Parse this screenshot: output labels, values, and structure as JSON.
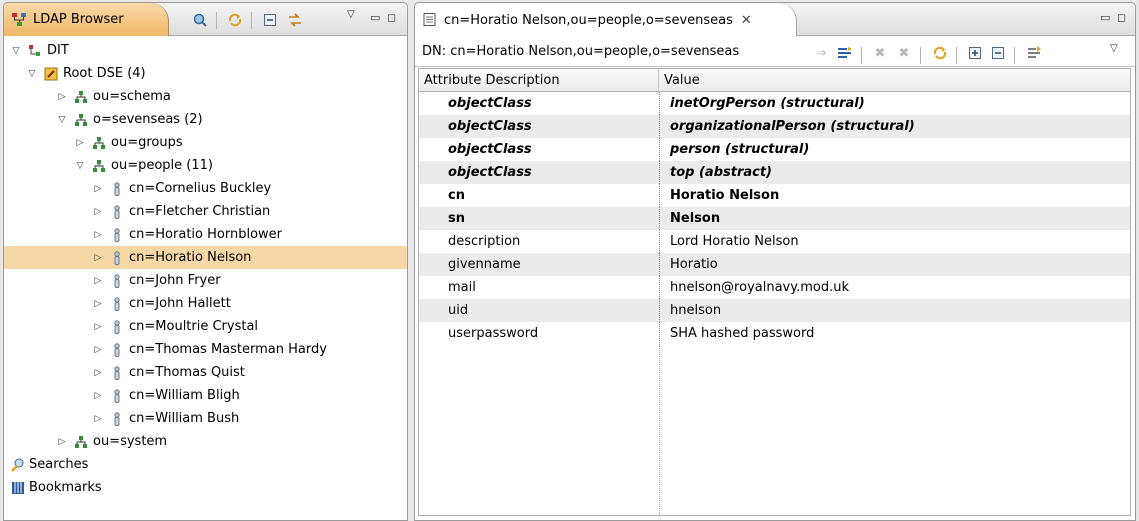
{
  "browser_panel": {
    "tab_label": "LDAP Browser",
    "toolbar_icons": [
      "search-icon",
      "refresh-icon",
      "collapse-all-icon",
      "link-with-editor-icon",
      "view-menu-icon"
    ]
  },
  "tree": {
    "rows": [
      {
        "label": "DIT",
        "expanded": true,
        "icon": "dit-icon"
      },
      {
        "label": "Root DSE (4)",
        "expanded": true,
        "icon": "root-dse-icon"
      },
      {
        "label": "ou=schema",
        "expanded": false,
        "icon": "ou-icon"
      },
      {
        "label": "o=sevenseas (2)",
        "expanded": true,
        "icon": "ou-icon"
      },
      {
        "label": "ou=groups",
        "expanded": false,
        "icon": "ou-icon"
      },
      {
        "label": "ou=people (11)",
        "expanded": true,
        "icon": "ou-icon"
      },
      {
        "label": "cn=Cornelius Buckley",
        "expanded": false,
        "icon": "person-icon"
      },
      {
        "label": "cn=Fletcher Christian",
        "expanded": false,
        "icon": "person-icon"
      },
      {
        "label": "cn=Horatio Hornblower",
        "expanded": false,
        "icon": "person-icon"
      },
      {
        "label": "cn=Horatio Nelson",
        "expanded": false,
        "icon": "person-icon",
        "selected": true
      },
      {
        "label": "cn=John Fryer",
        "expanded": false,
        "icon": "person-icon"
      },
      {
        "label": "cn=John Hallett",
        "expanded": false,
        "icon": "person-icon"
      },
      {
        "label": "cn=Moultrie Crystal",
        "expanded": false,
        "icon": "person-icon"
      },
      {
        "label": "cn=Thomas Masterman Hardy",
        "expanded": false,
        "icon": "person-icon"
      },
      {
        "label": "cn=Thomas Quist",
        "expanded": false,
        "icon": "person-icon"
      },
      {
        "label": "cn=William Bligh",
        "expanded": false,
        "icon": "person-icon"
      },
      {
        "label": "cn=William Bush",
        "expanded": false,
        "icon": "person-icon"
      },
      {
        "label": "ou=system",
        "expanded": false,
        "icon": "ou-icon"
      },
      {
        "label": "Searches",
        "icon": "searches-icon"
      },
      {
        "label": "Bookmarks",
        "icon": "bookmarks-icon"
      }
    ]
  },
  "editor": {
    "tab_label": "cn=Horatio Nelson,ou=people,o=sevenseas",
    "dn_label": "DN: cn=Horatio Nelson,ou=people,o=sevenseas",
    "toolbar_icons": [
      "new-value-icon",
      "new-attribute-icon",
      "delete-icon",
      "delete-all-icon",
      "refresh-icon",
      "expand-all-icon",
      "collapse-all-icon",
      "show-decorated-values-icon",
      "view-menu-icon"
    ],
    "columns": [
      "Attribute Description",
      "Value"
    ],
    "rows": [
      {
        "attr": "objectClass",
        "value": "inetOrgPerson (structural)",
        "style": "bi"
      },
      {
        "attr": "objectClass",
        "value": "organizationalPerson (structural)",
        "style": "bi"
      },
      {
        "attr": "objectClass",
        "value": "person (structural)",
        "style": "bi"
      },
      {
        "attr": "objectClass",
        "value": "top (abstract)",
        "style": "bi"
      },
      {
        "attr": "cn",
        "value": "Horatio Nelson",
        "style": "b"
      },
      {
        "attr": "sn",
        "value": "Nelson",
        "style": "b"
      },
      {
        "attr": "description",
        "value": "Lord Horatio Nelson",
        "style": ""
      },
      {
        "attr": "givenname",
        "value": "Horatio",
        "style": ""
      },
      {
        "attr": "mail",
        "value": "hnelson@royalnavy.mod.uk",
        "style": ""
      },
      {
        "attr": "uid",
        "value": "hnelson",
        "style": ""
      },
      {
        "attr": "userpassword",
        "value": "SHA hashed password",
        "style": ""
      }
    ]
  },
  "colors": {
    "selection": "#f6d8a6",
    "active_tab": "#f0b86a",
    "alt_row": "#ebebeb"
  }
}
